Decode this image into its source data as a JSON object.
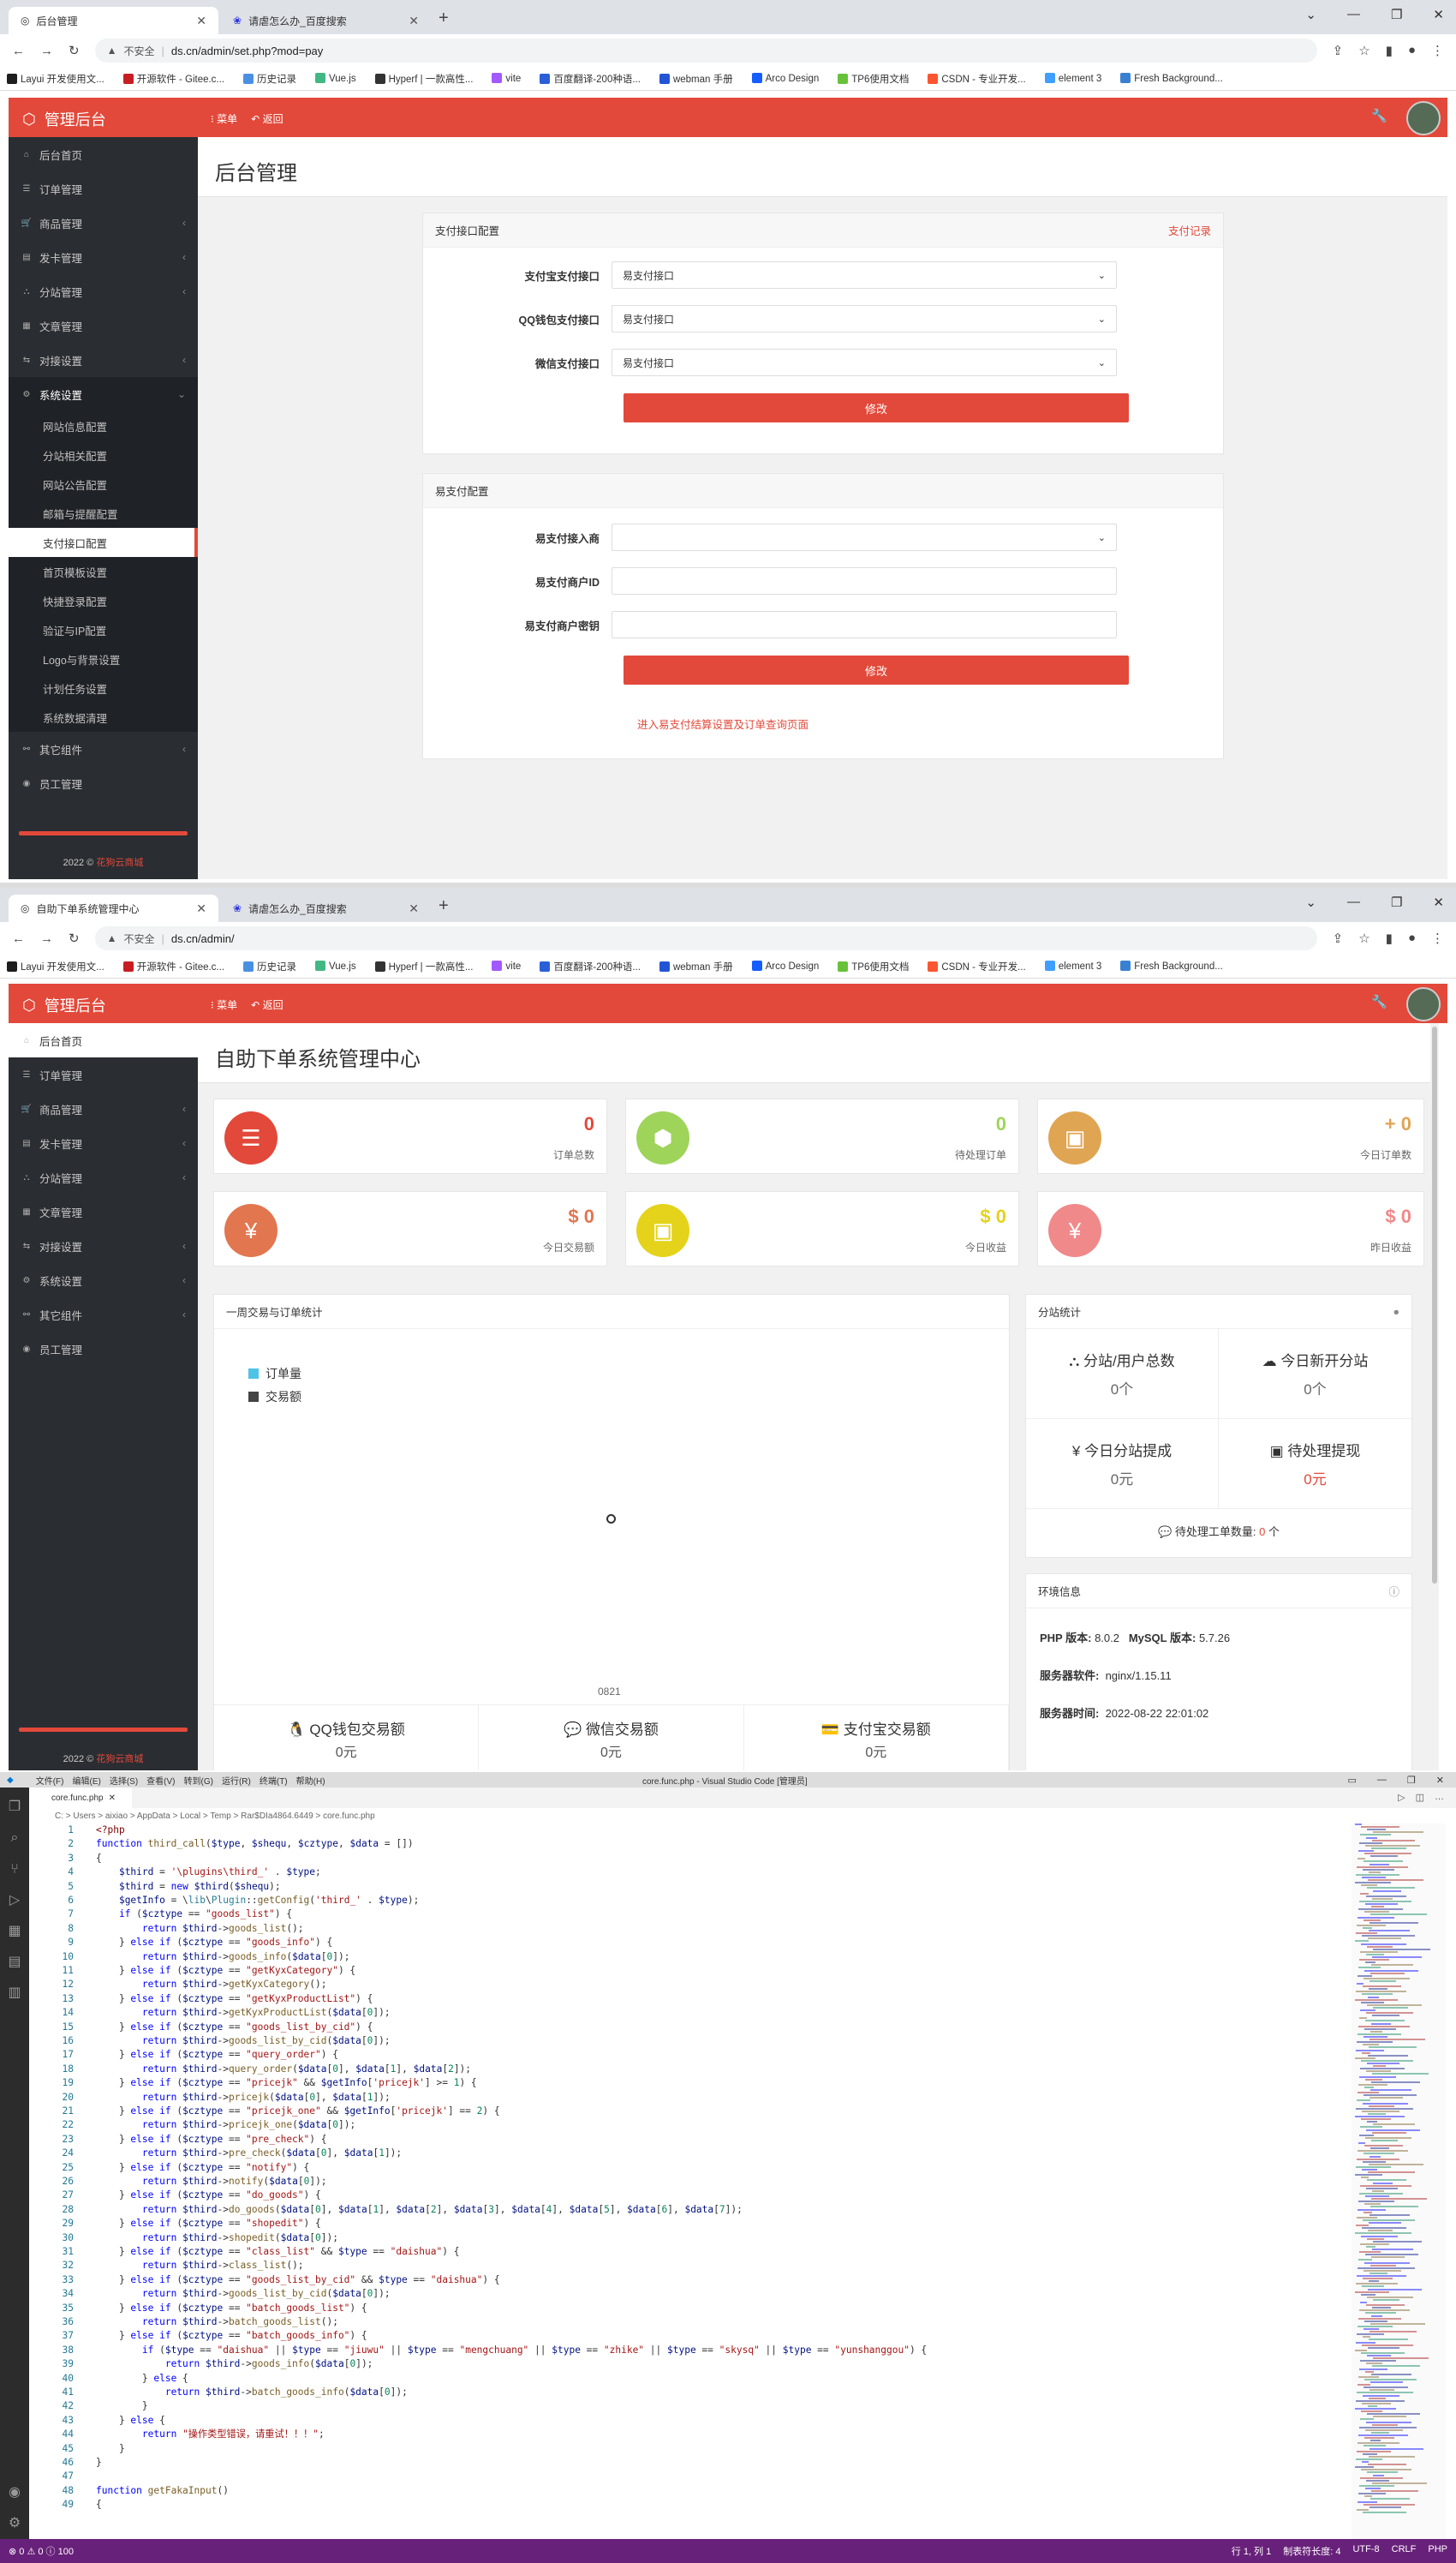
{
  "browser_top": {
    "tabs": [
      "后台管理",
      "请虐怎么办_百度搜索"
    ],
    "url": "ds.cn/admin/set.php?mod=pay",
    "insecure": "不安全"
  },
  "browser_bottom": {
    "tabs": [
      "自助下单系统管理中心",
      "请虐怎么办_百度搜索"
    ],
    "url": "ds.cn/admin/",
    "insecure": "不安全"
  },
  "bookmarks": [
    "Layui 开发使用文...",
    "开源软件 - Gitee.c...",
    "历史记录",
    "Vue.js",
    "Hyperf | 一款高性...",
    "vite",
    "百度翻译-200种语...",
    "webman 手册",
    "Arco Design",
    "TP6使用文档",
    "CSDN - 专业开发...",
    "element 3",
    "Fresh Background..."
  ],
  "bookmark_colors": [
    "#1e1e1e",
    "#c71d23",
    "#4a90e2",
    "#41b883",
    "#333333",
    "#a259ff",
    "#2b5fd9",
    "#2254d6",
    "#165dff",
    "#67c23a",
    "#fc5531",
    "#409eff",
    "#3a80d2"
  ],
  "app": {
    "brand": "管理后台",
    "menu": "菜单",
    "back": "返回",
    "accent": "#e2493a",
    "copyright_year": "2022 ©",
    "copyright_name": "花狗云商城"
  },
  "side_top": [
    "后台首页",
    "订单管理",
    "商品管理",
    "发卡管理",
    "分站管理",
    "文章管理",
    "对接设置",
    "系统设置"
  ],
  "side_sub": [
    "网站信息配置",
    "分站相关配置",
    "网站公告配置",
    "邮箱与提醒配置",
    "支付接口配置",
    "首页模板设置",
    "快捷登录配置",
    "验证与IP配置",
    "Logo与背景设置",
    "计划任务设置",
    "系统数据清理"
  ],
  "side_bottom": [
    "其它组件",
    "员工管理"
  ],
  "side2": [
    "后台首页",
    "订单管理",
    "商品管理",
    "发卡管理",
    "分站管理",
    "文章管理",
    "对接设置",
    "系统设置",
    "其它组件",
    "员工管理"
  ],
  "pay": {
    "title": "后台管理",
    "panel1": {
      "head": "支付接口配置",
      "link": "支付记录",
      "rows": [
        {
          "label": "支付宝支付接口",
          "value": "易支付接口"
        },
        {
          "label": "QQ钱包支付接口",
          "value": "易支付接口"
        },
        {
          "label": "微信支付接口",
          "value": "易支付接口"
        }
      ],
      "btn": "修改"
    },
    "panel2": {
      "head": "易支付配置",
      "rows": [
        {
          "label": "易支付接入商",
          "value": ""
        },
        {
          "label": "易支付商户ID",
          "value": ""
        },
        {
          "label": "易支付商户密钥",
          "value": ""
        }
      ],
      "btn": "修改",
      "link": "进入易支付结算设置及订单查询页面"
    }
  },
  "dash": {
    "title": "自助下单系统管理中心",
    "stats": [
      {
        "value": "0",
        "label": "订单总数",
        "color": "#e2493a",
        "icon": "list-icon",
        "glyph": "☰"
      },
      {
        "value": "0",
        "label": "待处理订单",
        "color": "#9ed45a",
        "icon": "cube-icon",
        "glyph": "⬢"
      },
      {
        "value": "+ 0",
        "label": "今日订单数",
        "color": "#e0a552",
        "icon": "briefcase-icon",
        "glyph": "▣"
      },
      {
        "value": "$ 0",
        "label": "今日交易额",
        "color": "#e2764f",
        "icon": "yen-icon",
        "glyph": "¥"
      },
      {
        "value": "$ 0",
        "label": "今日收益",
        "color": "#e4d31a",
        "icon": "briefcase-icon",
        "glyph": "▣"
      },
      {
        "value": "$ 0",
        "label": "昨日收益",
        "color": "#f0898a",
        "icon": "yen-icon",
        "glyph": "¥"
      }
    ],
    "chart": {
      "head": "一周交易与订单统计",
      "legend": [
        "订单量",
        "交易额"
      ],
      "xtick": "0821"
    },
    "bottom": [
      {
        "label": "QQ钱包交易额",
        "value": "0元"
      },
      {
        "label": "微信交易额",
        "value": "0元"
      },
      {
        "label": "支付宝交易额",
        "value": "0元"
      }
    ],
    "sub": {
      "head": "分站统计",
      "cells": [
        {
          "label": "分站/用户总数",
          "value": "0个"
        },
        {
          "label": "今日新开分站",
          "value": "0个"
        },
        {
          "label": "今日分站提成",
          "value": "0元"
        },
        {
          "label": "待处理提现",
          "value": "0元"
        }
      ],
      "ticket": "待处理工单数量:",
      "ticket_val": "0",
      "ticket_unit": "个"
    },
    "env": {
      "head": "环境信息",
      "php_l": "PHP 版本:",
      "php": "8.0.2",
      "mysql_l": "MySQL 版本:",
      "mysql": "5.7.26",
      "srv_l": "服务器软件:",
      "srv": "nginx/1.15.11",
      "time_l": "服务器时间:",
      "time": "2022-08-22 22:01:02"
    }
  },
  "vscode": {
    "title": "core.func.php - Visual Studio Code [管理员]",
    "menu": [
      "文件(F)",
      "编辑(E)",
      "选择(S)",
      "查看(V)",
      "转到(G)",
      "运行(R)",
      "终端(T)",
      "帮助(H)"
    ],
    "tab": "core.func.php",
    "crumb": "C: > Users > aixiao > AppData > Local > Temp > Rar$DIa4864.6449 > core.func.php",
    "status_left": "⊗ 0 ⚠ 0 ⓘ 100",
    "status_right": [
      "行 1, 列 1",
      "制表符长度: 4",
      "UTF-8",
      "CRLF",
      "PHP"
    ],
    "lines": [
      "<span class=p>&lt;?php</span>",
      "<span class=k>function</span> <span class=f>third_call</span>(<span class=v>$type</span>, <span class=v>$shequ</span>, <span class=v>$cztype</span>, <span class=v>$data</span> = [])",
      "{",
      "    <span class=v>$third</span> = <span class=s>'\\plugins\\third_'</span> . <span class=v>$type</span>;",
      "    <span class=v>$third</span> = <span class=k>new</span> <span class=v>$third</span>(<span class=v>$shequ</span>);",
      "    <span class=v>$getInfo</span> = \\<span class=t2>lib</span>\\<span class=t2>Plugin</span>::<span class=f>getConfig</span>(<span class=s>'third_'</span> . <span class=v>$type</span>);",
      "    <span class=k>if</span> (<span class=v>$cztype</span> == <span class=s>\"goods_list\"</span>) {",
      "        <span class=k>return</span> <span class=v>$third</span>-&gt;<span class=f>goods_list</span>();",
      "    } <span class=k>else if</span> (<span class=v>$cztype</span> == <span class=s>\"goods_info\"</span>) {",
      "        <span class=k>return</span> <span class=v>$third</span>-&gt;<span class=f>goods_info</span>(<span class=v>$data</span>[<span class=n>0</span>]);",
      "    } <span class=k>else if</span> (<span class=v>$cztype</span> == <span class=s>\"getKyxCategory\"</span>) {",
      "        <span class=k>return</span> <span class=v>$third</span>-&gt;<span class=f>getKyxCategory</span>();",
      "    } <span class=k>else if</span> (<span class=v>$cztype</span> == <span class=s>\"getKyxProductList\"</span>) {",
      "        <span class=k>return</span> <span class=v>$third</span>-&gt;<span class=f>getKyxProductList</span>(<span class=v>$data</span>[<span class=n>0</span>]);",
      "    } <span class=k>else if</span> (<span class=v>$cztype</span> == <span class=s>\"goods_list_by_cid\"</span>) {",
      "        <span class=k>return</span> <span class=v>$third</span>-&gt;<span class=f>goods_list_by_cid</span>(<span class=v>$data</span>[<span class=n>0</span>]);",
      "    } <span class=k>else if</span> (<span class=v>$cztype</span> == <span class=s>\"query_order\"</span>) {",
      "        <span class=k>return</span> <span class=v>$third</span>-&gt;<span class=f>query_order</span>(<span class=v>$data</span>[<span class=n>0</span>], <span class=v>$data</span>[<span class=n>1</span>], <span class=v>$data</span>[<span class=n>2</span>]);",
      "    } <span class=k>else if</span> (<span class=v>$cztype</span> == <span class=s>\"pricejk\"</span> &amp;&amp; <span class=v>$getInfo</span>[<span class=s>'pricejk'</span>] &gt;= <span class=n>1</span>) {",
      "        <span class=k>return</span> <span class=v>$third</span>-&gt;<span class=f>pricejk</span>(<span class=v>$data</span>[<span class=n>0</span>], <span class=v>$data</span>[<span class=n>1</span>]);",
      "    } <span class=k>else if</span> (<span class=v>$cztype</span> == <span class=s>\"pricejk_one\"</span> &amp;&amp; <span class=v>$getInfo</span>[<span class=s>'pricejk'</span>] == <span class=n>2</span>) {",
      "        <span class=k>return</span> <span class=v>$third</span>-&gt;<span class=f>pricejk_one</span>(<span class=v>$data</span>[<span class=n>0</span>]);",
      "    } <span class=k>else if</span> (<span class=v>$cztype</span> == <span class=s>\"pre_check\"</span>) {",
      "        <span class=k>return</span> <span class=v>$third</span>-&gt;<span class=f>pre_check</span>(<span class=v>$data</span>[<span class=n>0</span>], <span class=v>$data</span>[<span class=n>1</span>]);",
      "    } <span class=k>else if</span> (<span class=v>$cztype</span> == <span class=s>\"notify\"</span>) {",
      "        <span class=k>return</span> <span class=v>$third</span>-&gt;<span class=f>notify</span>(<span class=v>$data</span>[<span class=n>0</span>]);",
      "    } <span class=k>else if</span> (<span class=v>$cztype</span> == <span class=s>\"do_goods\"</span>) {",
      "        <span class=k>return</span> <span class=v>$third</span>-&gt;<span class=f>do_goods</span>(<span class=v>$data</span>[<span class=n>0</span>], <span class=v>$data</span>[<span class=n>1</span>], <span class=v>$data</span>[<span class=n>2</span>], <span class=v>$data</span>[<span class=n>3</span>], <span class=v>$data</span>[<span class=n>4</span>], <span class=v>$data</span>[<span class=n>5</span>], <span class=v>$data</span>[<span class=n>6</span>], <span class=v>$data</span>[<span class=n>7</span>]);",
      "    } <span class=k>else if</span> (<span class=v>$cztype</span> == <span class=s>\"shopedit\"</span>) {",
      "        <span class=k>return</span> <span class=v>$third</span>-&gt;<span class=f>shopedit</span>(<span class=v>$data</span>[<span class=n>0</span>]);",
      "    } <span class=k>else if</span> (<span class=v>$cztype</span> == <span class=s>\"class_list\"</span> &amp;&amp; <span class=v>$type</span> == <span class=s>\"daishua\"</span>) {",
      "        <span class=k>return</span> <span class=v>$third</span>-&gt;<span class=f>class_list</span>();",
      "    } <span class=k>else if</span> (<span class=v>$cztype</span> == <span class=s>\"goods_list_by_cid\"</span> &amp;&amp; <span class=v>$type</span> == <span class=s>\"daishua\"</span>) {",
      "        <span class=k>return</span> <span class=v>$third</span>-&gt;<span class=f>goods_list_by_cid</span>(<span class=v>$data</span>[<span class=n>0</span>]);",
      "    } <span class=k>else if</span> (<span class=v>$cztype</span> == <span class=s>\"batch_goods_list\"</span>) {",
      "        <span class=k>return</span> <span class=v>$third</span>-&gt;<span class=f>batch_goods_list</span>();",
      "    } <span class=k>else if</span> (<span class=v>$cztype</span> == <span class=s>\"batch_goods_info\"</span>) {",
      "        <span class=k>if</span> (<span class=v>$type</span> == <span class=s>\"daishua\"</span> || <span class=v>$type</span> == <span class=s>\"jiuwu\"</span> || <span class=v>$type</span> == <span class=s>\"mengchuang\"</span> || <span class=v>$type</span> == <span class=s>\"zhike\"</span> || <span class=v>$type</span> == <span class=s>\"skysq\"</span> || <span class=v>$type</span> == <span class=s>\"yunshanggou\"</span>) {",
      "            <span class=k>return</span> <span class=v>$third</span>-&gt;<span class=f>goods_info</span>(<span class=v>$data</span>[<span class=n>0</span>]);",
      "        } <span class=k>else</span> {",
      "            <span class=k>return</span> <span class=v>$third</span>-&gt;<span class=f>batch_goods_info</span>(<span class=v>$data</span>[<span class=n>0</span>]);",
      "        }",
      "    } <span class=k>else</span> {",
      "        <span class=k>return</span> <span class=s>\"操作类型错误，请重试！！！\"</span>;",
      "    }",
      "}",
      "",
      "<span class=k>function</span> <span class=f>getFakaInput</span>()",
      "{"
    ]
  }
}
